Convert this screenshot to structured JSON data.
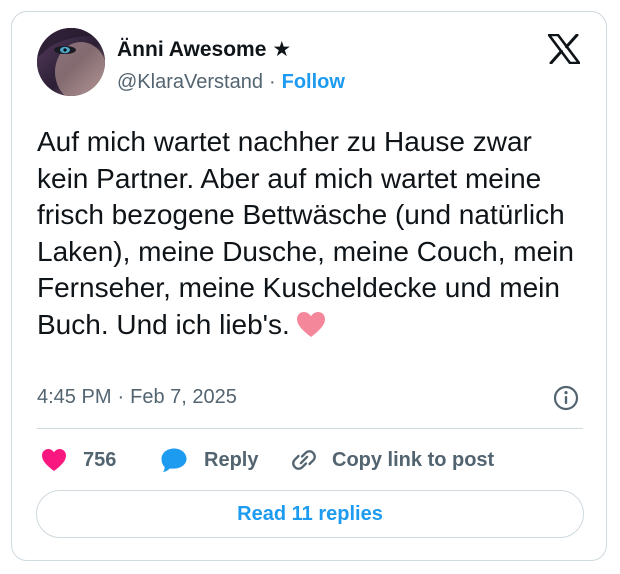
{
  "author": {
    "display_name": "Änni Awesome",
    "badge_symbol": "★",
    "handle": "@KlaraVerstand",
    "separator": "·",
    "follow_label": "Follow"
  },
  "tweet": {
    "text": "Auf mich wartet nachher zu Hause zwar kein Partner. Aber auf mich wartet meine frisch bezogene Bettwäsche (und natürlich Laken), meine Dusche, meine Couch, mein Fernseher, meine Kuscheldecke und mein Buch. Und ich lieb's.",
    "emoji": "pink-heart-icon",
    "time": "4:45 PM",
    "date_separator": "·",
    "date": "Feb 7, 2025"
  },
  "actions": {
    "like_count": "756",
    "reply_label": "Reply",
    "copy_label": "Copy link to post"
  },
  "replies_button": {
    "label": "Read 11 replies"
  },
  "colors": {
    "accent": "#1d9bf0",
    "like": "#f91880",
    "secondary_text": "#536471",
    "border": "#cfd9de",
    "emoji_heart": "#f4879a"
  }
}
